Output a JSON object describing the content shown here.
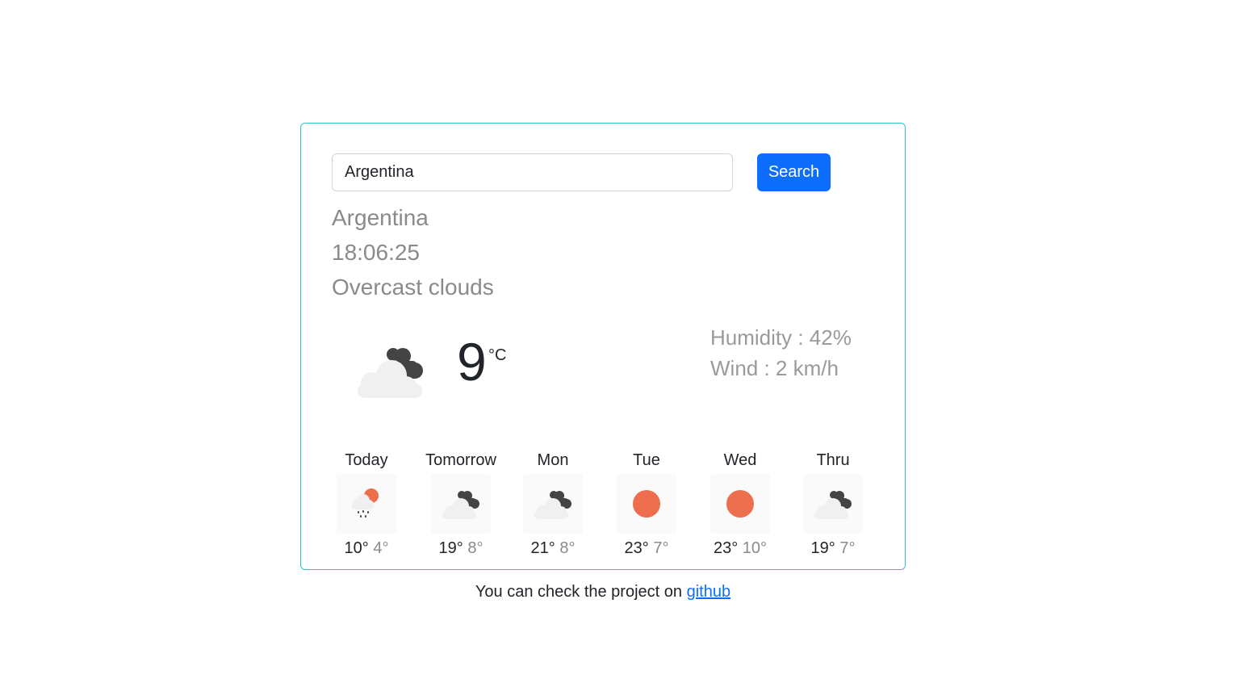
{
  "search": {
    "value": "Argentina",
    "placeholder": "",
    "button_label": "Search"
  },
  "current": {
    "location": "Argentina",
    "time": "18:06:25",
    "description": "Overcast clouds",
    "temperature": "9",
    "unit": "°C",
    "icon": "overcast-clouds-icon",
    "humidity": "Humidity : 42%",
    "wind": "Wind : 2 km/h"
  },
  "forecast": [
    {
      "day": "Today",
      "max": "10°",
      "min": "4°",
      "icon": "rain-sun-icon"
    },
    {
      "day": "Tomorrow",
      "max": "19°",
      "min": "8°",
      "icon": "overcast-clouds-icon"
    },
    {
      "day": "Mon",
      "max": "21°",
      "min": "8°",
      "icon": "overcast-clouds-icon"
    },
    {
      "day": "Tue",
      "max": "23°",
      "min": "7°",
      "icon": "sun-icon"
    },
    {
      "day": "Wed",
      "max": "23°",
      "min": "10°",
      "icon": "sun-icon"
    },
    {
      "day": "Thru",
      "max": "19°",
      "min": "7°",
      "icon": "overcast-clouds-icon"
    }
  ],
  "footer": {
    "text": "You can check the project on",
    "link_label": "github"
  },
  "colors": {
    "accent": "#0d6efd",
    "card_border": "#2fc4c4",
    "sun": "#ec6e4c",
    "cloud_dark": "#444444",
    "cloud_light": "#f0f0f0"
  }
}
